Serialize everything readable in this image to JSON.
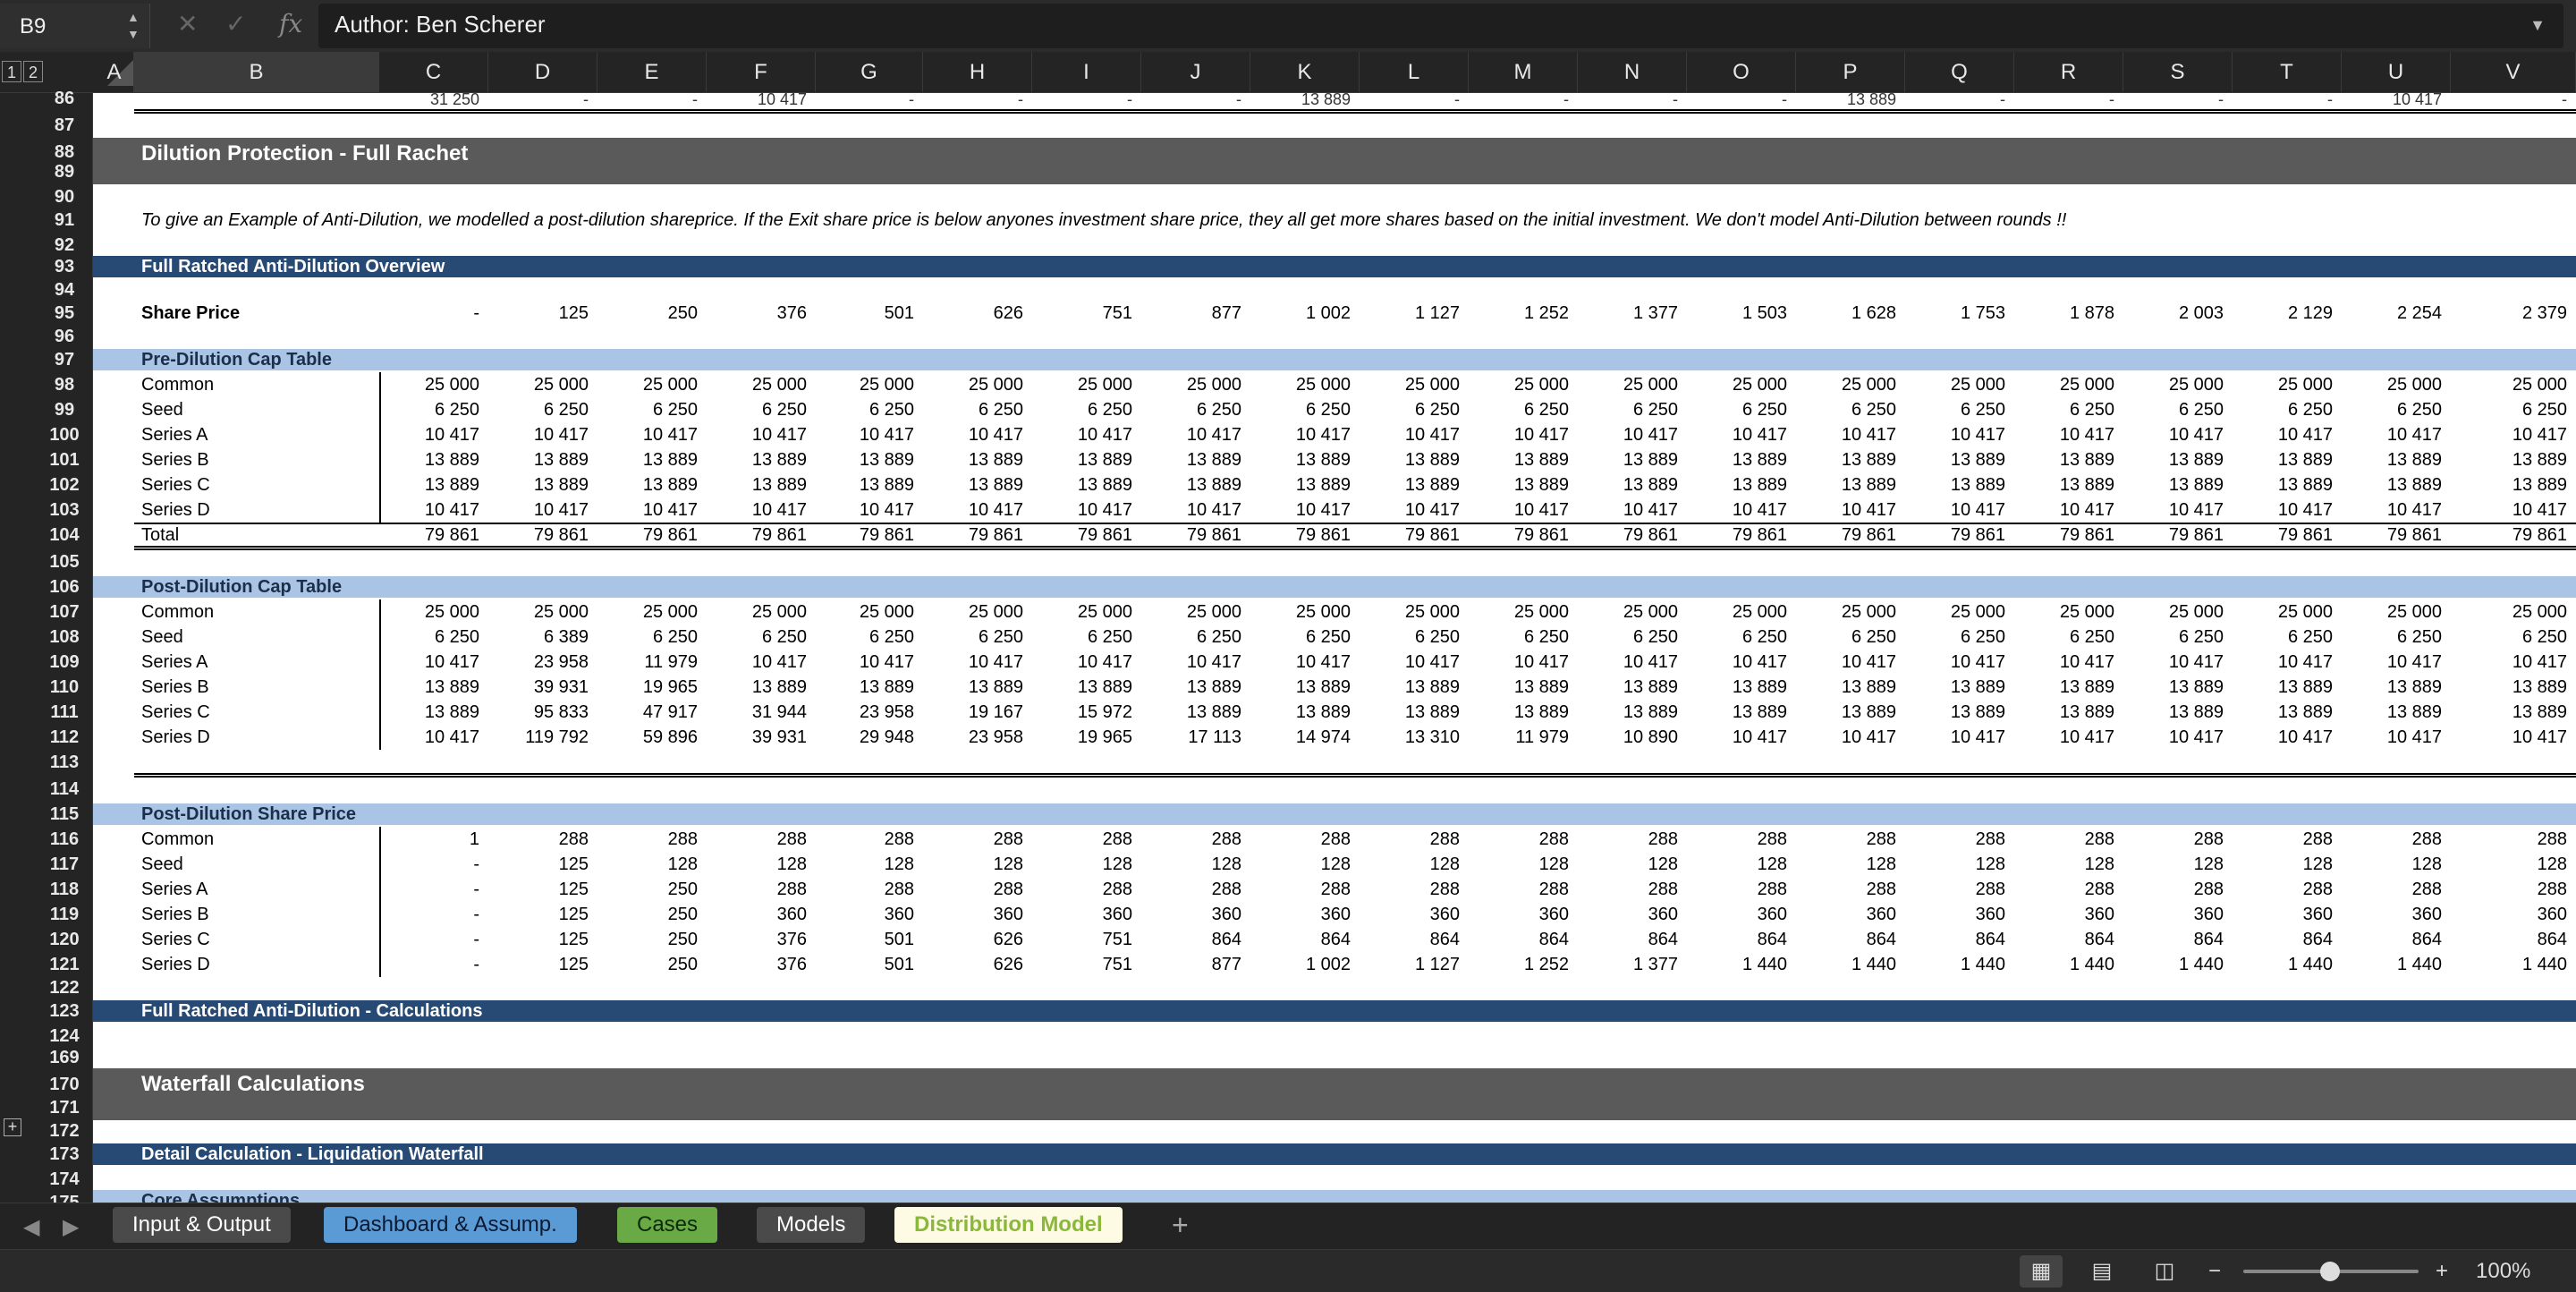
{
  "formula_bar": {
    "cell_ref": "B9",
    "cancel": "✕",
    "confirm": "✓",
    "fx": "fx",
    "content": "Author: Ben Scherer"
  },
  "outline_levels": [
    "1",
    "2"
  ],
  "columns": [
    "A",
    "B",
    "C",
    "D",
    "E",
    "F",
    "G",
    "H",
    "I",
    "J",
    "K",
    "L",
    "M",
    "N",
    "O",
    "P",
    "Q",
    "R",
    "S",
    "T",
    "U",
    "V"
  ],
  "selected_column": "B",
  "row_numbers": [
    "86",
    "87",
    "88",
    "89",
    "90",
    "91",
    "92",
    "93",
    "94",
    "95",
    "96",
    "97",
    "98",
    "99",
    "100",
    "101",
    "102",
    "103",
    "104",
    "105",
    "106",
    "107",
    "108",
    "109",
    "110",
    "111",
    "112",
    "113",
    "114",
    "115",
    "116",
    "117",
    "118",
    "119",
    "120",
    "121",
    "122",
    "123",
    "124",
    "169",
    "170",
    "171",
    "172",
    "173",
    "174",
    "175"
  ],
  "partial_row_86": [
    "31 250",
    "-",
    "-",
    "10 417",
    "-",
    "-",
    "-",
    "-",
    "13 889",
    "-",
    "-",
    "-",
    "-",
    "13 889",
    "-",
    "-",
    "-",
    "-",
    "10 417",
    "-"
  ],
  "section_dilution": "Dilution Protection - Full Rachet",
  "note_text": "To give an Example of Anti-Dilution, we modelled a post-dilution shareprice. If the Exit share price is below anyones investment share price, they all get more shares based on the initial investment. We don't model Anti-Dilution between rounds !!",
  "overview_title": "Full Ratched Anti-Dilution Overview",
  "share_price": {
    "label": "Share Price",
    "values": [
      "-",
      "125",
      "250",
      "376",
      "501",
      "626",
      "751",
      "877",
      "1 002",
      "1 127",
      "1 252",
      "1 377",
      "1 503",
      "1 628",
      "1 753",
      "1 878",
      "2 003",
      "2 129",
      "2 254",
      "2 379"
    ]
  },
  "pre_dilution": {
    "title": "Pre-Dilution Cap Table",
    "rows": [
      {
        "label": "Common",
        "values": [
          "25 000",
          "25 000",
          "25 000",
          "25 000",
          "25 000",
          "25 000",
          "25 000",
          "25 000",
          "25 000",
          "25 000",
          "25 000",
          "25 000",
          "25 000",
          "25 000",
          "25 000",
          "25 000",
          "25 000",
          "25 000",
          "25 000",
          "25 000"
        ]
      },
      {
        "label": "Seed",
        "values": [
          "6 250",
          "6 250",
          "6 250",
          "6 250",
          "6 250",
          "6 250",
          "6 250",
          "6 250",
          "6 250",
          "6 250",
          "6 250",
          "6 250",
          "6 250",
          "6 250",
          "6 250",
          "6 250",
          "6 250",
          "6 250",
          "6 250",
          "6 250"
        ]
      },
      {
        "label": "Series A",
        "values": [
          "10 417",
          "10 417",
          "10 417",
          "10 417",
          "10 417",
          "10 417",
          "10 417",
          "10 417",
          "10 417",
          "10 417",
          "10 417",
          "10 417",
          "10 417",
          "10 417",
          "10 417",
          "10 417",
          "10 417",
          "10 417",
          "10 417",
          "10 417"
        ]
      },
      {
        "label": "Series B",
        "values": [
          "13 889",
          "13 889",
          "13 889",
          "13 889",
          "13 889",
          "13 889",
          "13 889",
          "13 889",
          "13 889",
          "13 889",
          "13 889",
          "13 889",
          "13 889",
          "13 889",
          "13 889",
          "13 889",
          "13 889",
          "13 889",
          "13 889",
          "13 889"
        ]
      },
      {
        "label": "Series C",
        "values": [
          "13 889",
          "13 889",
          "13 889",
          "13 889",
          "13 889",
          "13 889",
          "13 889",
          "13 889",
          "13 889",
          "13 889",
          "13 889",
          "13 889",
          "13 889",
          "13 889",
          "13 889",
          "13 889",
          "13 889",
          "13 889",
          "13 889",
          "13 889"
        ]
      },
      {
        "label": "Series D",
        "values": [
          "10 417",
          "10 417",
          "10 417",
          "10 417",
          "10 417",
          "10 417",
          "10 417",
          "10 417",
          "10 417",
          "10 417",
          "10 417",
          "10 417",
          "10 417",
          "10 417",
          "10 417",
          "10 417",
          "10 417",
          "10 417",
          "10 417",
          "10 417"
        ]
      },
      {
        "label": "Total",
        "values": [
          "79 861",
          "79 861",
          "79 861",
          "79 861",
          "79 861",
          "79 861",
          "79 861",
          "79 861",
          "79 861",
          "79 861",
          "79 861",
          "79 861",
          "79 861",
          "79 861",
          "79 861",
          "79 861",
          "79 861",
          "79 861",
          "79 861",
          "79 861"
        ]
      }
    ]
  },
  "post_dilution": {
    "title": "Post-Dilution Cap Table",
    "rows": [
      {
        "label": "Common",
        "values": [
          "25 000",
          "25 000",
          "25 000",
          "25 000",
          "25 000",
          "25 000",
          "25 000",
          "25 000",
          "25 000",
          "25 000",
          "25 000",
          "25 000",
          "25 000",
          "25 000",
          "25 000",
          "25 000",
          "25 000",
          "25 000",
          "25 000",
          "25 000"
        ]
      },
      {
        "label": "Seed",
        "values": [
          "6 250",
          "6 389",
          "6 250",
          "6 250",
          "6 250",
          "6 250",
          "6 250",
          "6 250",
          "6 250",
          "6 250",
          "6 250",
          "6 250",
          "6 250",
          "6 250",
          "6 250",
          "6 250",
          "6 250",
          "6 250",
          "6 250",
          "6 250"
        ]
      },
      {
        "label": "Series A",
        "values": [
          "10 417",
          "23 958",
          "11 979",
          "10 417",
          "10 417",
          "10 417",
          "10 417",
          "10 417",
          "10 417",
          "10 417",
          "10 417",
          "10 417",
          "10 417",
          "10 417",
          "10 417",
          "10 417",
          "10 417",
          "10 417",
          "10 417",
          "10 417"
        ]
      },
      {
        "label": "Series B",
        "values": [
          "13 889",
          "39 931",
          "19 965",
          "13 889",
          "13 889",
          "13 889",
          "13 889",
          "13 889",
          "13 889",
          "13 889",
          "13 889",
          "13 889",
          "13 889",
          "13 889",
          "13 889",
          "13 889",
          "13 889",
          "13 889",
          "13 889",
          "13 889"
        ]
      },
      {
        "label": "Series C",
        "values": [
          "13 889",
          "95 833",
          "47 917",
          "31 944",
          "23 958",
          "19 167",
          "15 972",
          "13 889",
          "13 889",
          "13 889",
          "13 889",
          "13 889",
          "13 889",
          "13 889",
          "13 889",
          "13 889",
          "13 889",
          "13 889",
          "13 889",
          "13 889"
        ]
      },
      {
        "label": "Series D",
        "values": [
          "10 417",
          "119 792",
          "59 896",
          "39 931",
          "29 948",
          "23 958",
          "19 965",
          "17 113",
          "14 974",
          "13 310",
          "11 979",
          "10 890",
          "10 417",
          "10 417",
          "10 417",
          "10 417",
          "10 417",
          "10 417",
          "10 417",
          "10 417"
        ]
      }
    ]
  },
  "post_price": {
    "title": "Post-Dilution Share Price",
    "rows": [
      {
        "label": "Common",
        "values": [
          "1",
          "288",
          "288",
          "288",
          "288",
          "288",
          "288",
          "288",
          "288",
          "288",
          "288",
          "288",
          "288",
          "288",
          "288",
          "288",
          "288",
          "288",
          "288",
          "288"
        ]
      },
      {
        "label": "Seed",
        "values": [
          "-",
          "125",
          "128",
          "128",
          "128",
          "128",
          "128",
          "128",
          "128",
          "128",
          "128",
          "128",
          "128",
          "128",
          "128",
          "128",
          "128",
          "128",
          "128",
          "128"
        ]
      },
      {
        "label": "Series A",
        "values": [
          "-",
          "125",
          "250",
          "288",
          "288",
          "288",
          "288",
          "288",
          "288",
          "288",
          "288",
          "288",
          "288",
          "288",
          "288",
          "288",
          "288",
          "288",
          "288",
          "288"
        ]
      },
      {
        "label": "Series B",
        "values": [
          "-",
          "125",
          "250",
          "360",
          "360",
          "360",
          "360",
          "360",
          "360",
          "360",
          "360",
          "360",
          "360",
          "360",
          "360",
          "360",
          "360",
          "360",
          "360",
          "360"
        ]
      },
      {
        "label": "Series C",
        "values": [
          "-",
          "125",
          "250",
          "376",
          "501",
          "626",
          "751",
          "864",
          "864",
          "864",
          "864",
          "864",
          "864",
          "864",
          "864",
          "864",
          "864",
          "864",
          "864",
          "864"
        ]
      },
      {
        "label": "Series D",
        "values": [
          "-",
          "125",
          "250",
          "376",
          "501",
          "626",
          "751",
          "877",
          "1 002",
          "1 127",
          "1 252",
          "1 377",
          "1 440",
          "1 440",
          "1 440",
          "1 440",
          "1 440",
          "1 440",
          "1 440",
          "1 440"
        ]
      }
    ]
  },
  "calc_title": "Full Ratched Anti-Dilution - Calculations",
  "waterfall_title": "Waterfall Calculations",
  "liquidation_title": "Detail Calculation - Liquidation Waterfall",
  "core_assumptions": "Core Assumptions",
  "sheet_tabs": [
    {
      "label": "Input & Output",
      "bg": "#4a4a4a",
      "fg": "#ffffff"
    },
    {
      "label": "Dashboard & Assump.",
      "bg": "#5b9bd5",
      "fg": "#0b1a33"
    },
    {
      "label": "Cases",
      "bg": "#6aaa46",
      "fg": "#0b2a08"
    },
    {
      "label": "Models",
      "bg": "#4a4a4a",
      "fg": "#ffffff"
    },
    {
      "label": "Distribution Model",
      "bg": "#fdfbe3",
      "fg": "#8ab83a"
    }
  ],
  "add_sheet": "+",
  "zoom": {
    "minus": "−",
    "plus": "+",
    "level": "100%"
  }
}
